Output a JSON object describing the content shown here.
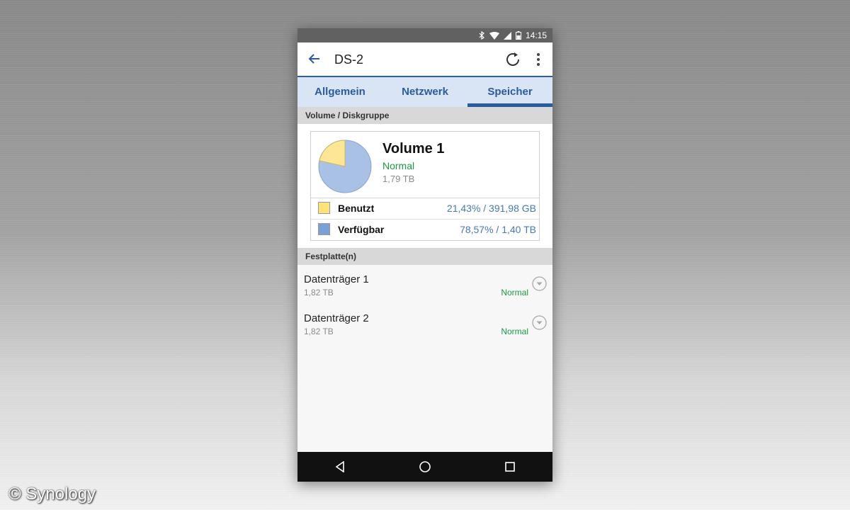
{
  "status_bar": {
    "time": "14:15"
  },
  "app_bar": {
    "title": "DS-2"
  },
  "tabs": [
    {
      "label": "Allgemein",
      "active": false
    },
    {
      "label": "Netzwerk",
      "active": false
    },
    {
      "label": "Speicher",
      "active": true
    }
  ],
  "volume_section": {
    "header": "Volume / Diskgruppe",
    "volume": {
      "name": "Volume 1",
      "status": "Normal",
      "size": "1,79 TB",
      "used_fraction": 0.2143,
      "legend": [
        {
          "label": "Benutzt",
          "value": "21,43% / 391,98 GB",
          "color": "#fde37a"
        },
        {
          "label": "Verfügbar",
          "value": "78,57% / 1,40 TB",
          "color": "#7aa0d8"
        }
      ]
    }
  },
  "disks_section": {
    "header": "Festplatte(n)",
    "disks": [
      {
        "name": "Datenträger 1",
        "size": "1,82 TB",
        "status": "Normal"
      },
      {
        "name": "Datenträger 2",
        "size": "1,82 TB",
        "status": "Normal"
      }
    ]
  },
  "colors": {
    "accent": "#2b5a9e",
    "status_ok": "#1a9a44",
    "tab_bg": "#d9e5f4"
  },
  "watermark": "© Synology"
}
